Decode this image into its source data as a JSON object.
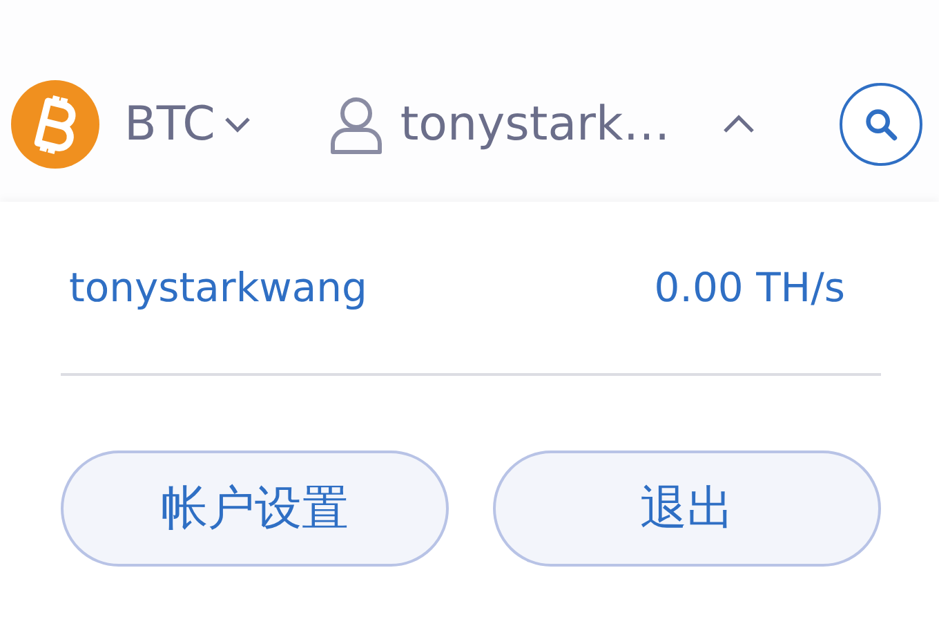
{
  "header": {
    "coin": {
      "symbol": "BTC"
    },
    "user": {
      "name": "tonystark…",
      "expanded": true
    }
  },
  "account_menu": {
    "username": "tonystarkwang",
    "hashrate": "0.00 TH/s",
    "buttons": [
      {
        "label": "帐户设置"
      },
      {
        "label": "退出"
      }
    ]
  }
}
